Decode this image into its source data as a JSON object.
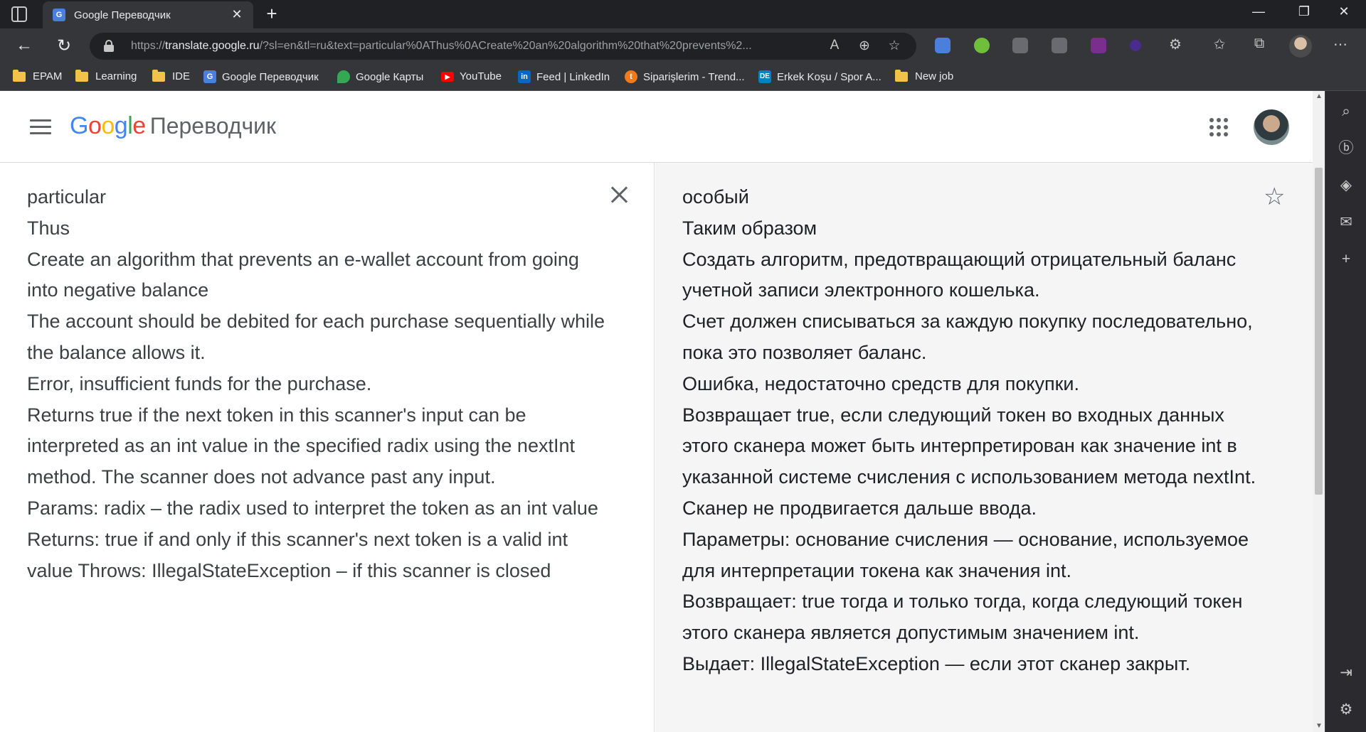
{
  "browser": {
    "tab": {
      "title": "Google Переводчик",
      "favicon": "G"
    },
    "url": {
      "prefix": "https://",
      "host": "translate.google.ru",
      "rest": "/?sl=en&tl=ru&text=particular%0AThus%0ACreate%20an%20algorithm%20that%20prevents%2..."
    },
    "bookmarks": [
      {
        "label": "EPAM",
        "icon": "folder-icon"
      },
      {
        "label": "Learning",
        "icon": "folder-icon"
      },
      {
        "label": "IDE",
        "icon": "folder-icon"
      },
      {
        "label": "Google Переводчик",
        "icon": "google-translate-icon"
      },
      {
        "label": "Google Карты",
        "icon": "google-maps-icon"
      },
      {
        "label": "YouTube",
        "icon": "youtube-icon"
      },
      {
        "label": "Feed | LinkedIn",
        "icon": "linkedin-icon"
      },
      {
        "label": "Siparişlerim - Trend...",
        "icon": "trendyol-icon"
      },
      {
        "label": "Erkek Koşu / Spor A...",
        "icon": "decathlon-icon"
      },
      {
        "label": "New job",
        "icon": "folder-icon"
      }
    ]
  },
  "app": {
    "logo": {
      "g1": "G",
      "g2": "o",
      "g3": "o",
      "g4": "g",
      "g5": "l",
      "g6": "e",
      "product": "Переводчик"
    }
  },
  "source": {
    "text": "particular\nThus\nCreate an algorithm that prevents an e-wallet account from going into negative balance\nThe account should be debited for each purchase sequentially while the balance allows it.\nError, insufficient funds for the purchase.\nReturns true if the next token in this scanner's input can be interpreted as an int value in the specified radix using the nextInt method. The scanner does not advance past any input.\nParams: radix – the radix used to interpret the token as an int value\nReturns: true if and only if this scanner's next token is a valid int value Throws: IllegalStateException – if this scanner is closed"
  },
  "target": {
    "text": "особый\nТаким образом\nСоздать алгоритм, предотвращающий отрицательный баланс учетной записи электронного кошелька.\nСчет должен списываться за каждую покупку последовательно, пока это позволяет баланс.\nОшибка, недостаточно средств для покупки.\nВозвращает true, если следующий токен во входных данных этого сканера может быть интерпретирован как значение int в указанной системе счисления с использованием метода nextInt. Сканер не продвигается дальше ввода.\nПараметры: основание счисления — основание, используемое для интерпретации токена как значения int.\nВозвращает: true тогда и только тогда, когда следующий токен этого сканера является допустимым значением int.\nВыдает: IllegalStateException — если этот сканер закрыт."
  }
}
